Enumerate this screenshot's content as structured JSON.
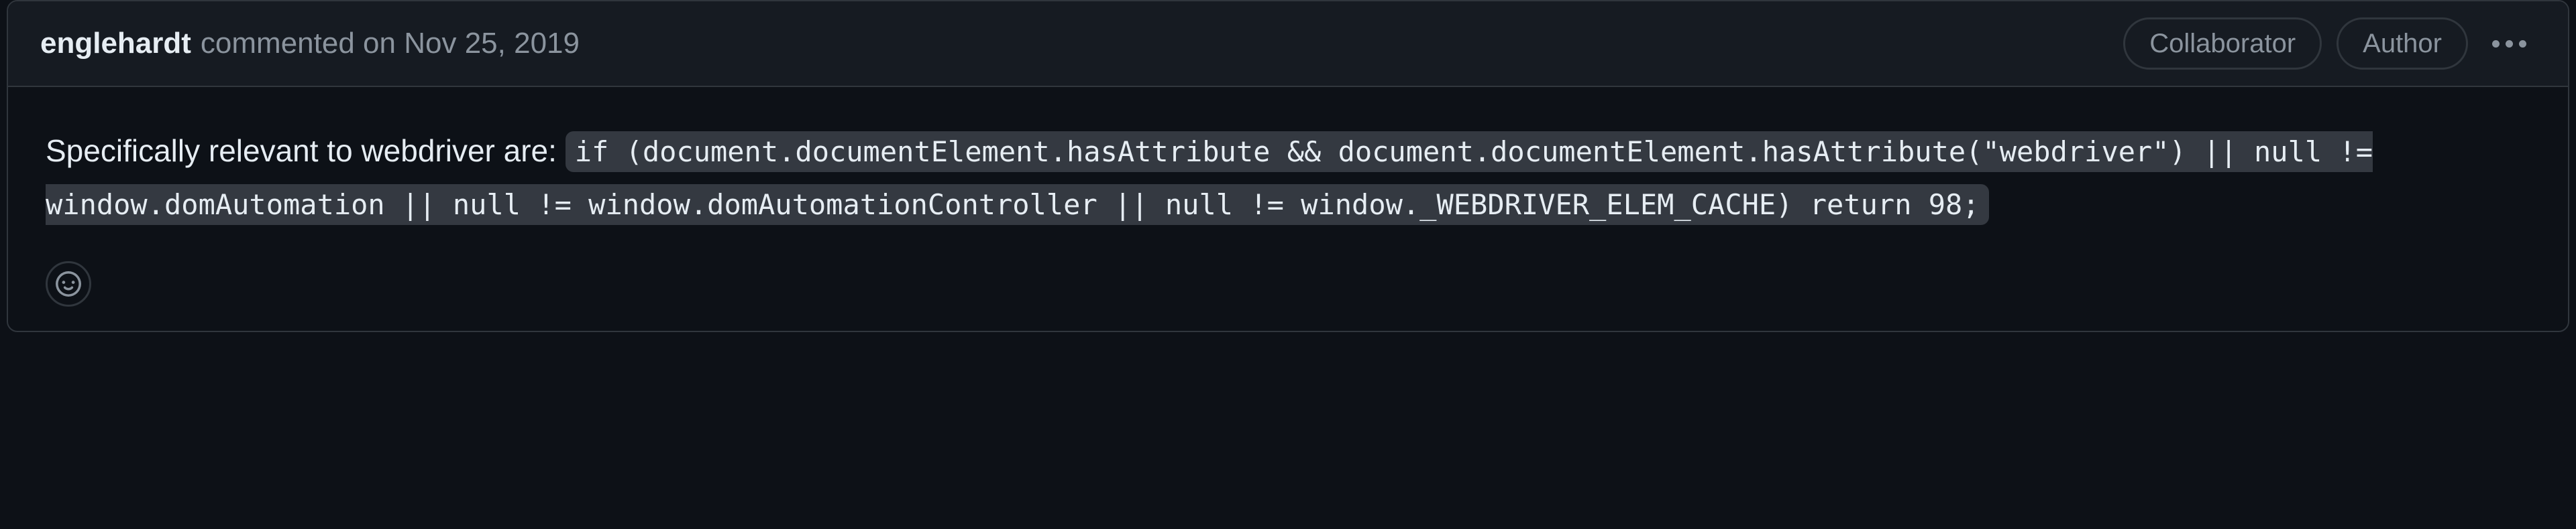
{
  "header": {
    "author": "englehardt",
    "commented_label": "commented",
    "on_label": "on",
    "date": "Nov 25, 2019",
    "badges": {
      "collaborator": "Collaborator",
      "author": "Author"
    }
  },
  "body": {
    "intro_text": "Specifically relevant to webdriver are: ",
    "code": "if (document.documentElement.hasAttribute && document.documentElement.hasAttribute(\"webdriver\") || null != window.domAutomation || null != window.domAutomationController || null != window._WEBDRIVER_ELEM_CACHE) return 98;"
  }
}
